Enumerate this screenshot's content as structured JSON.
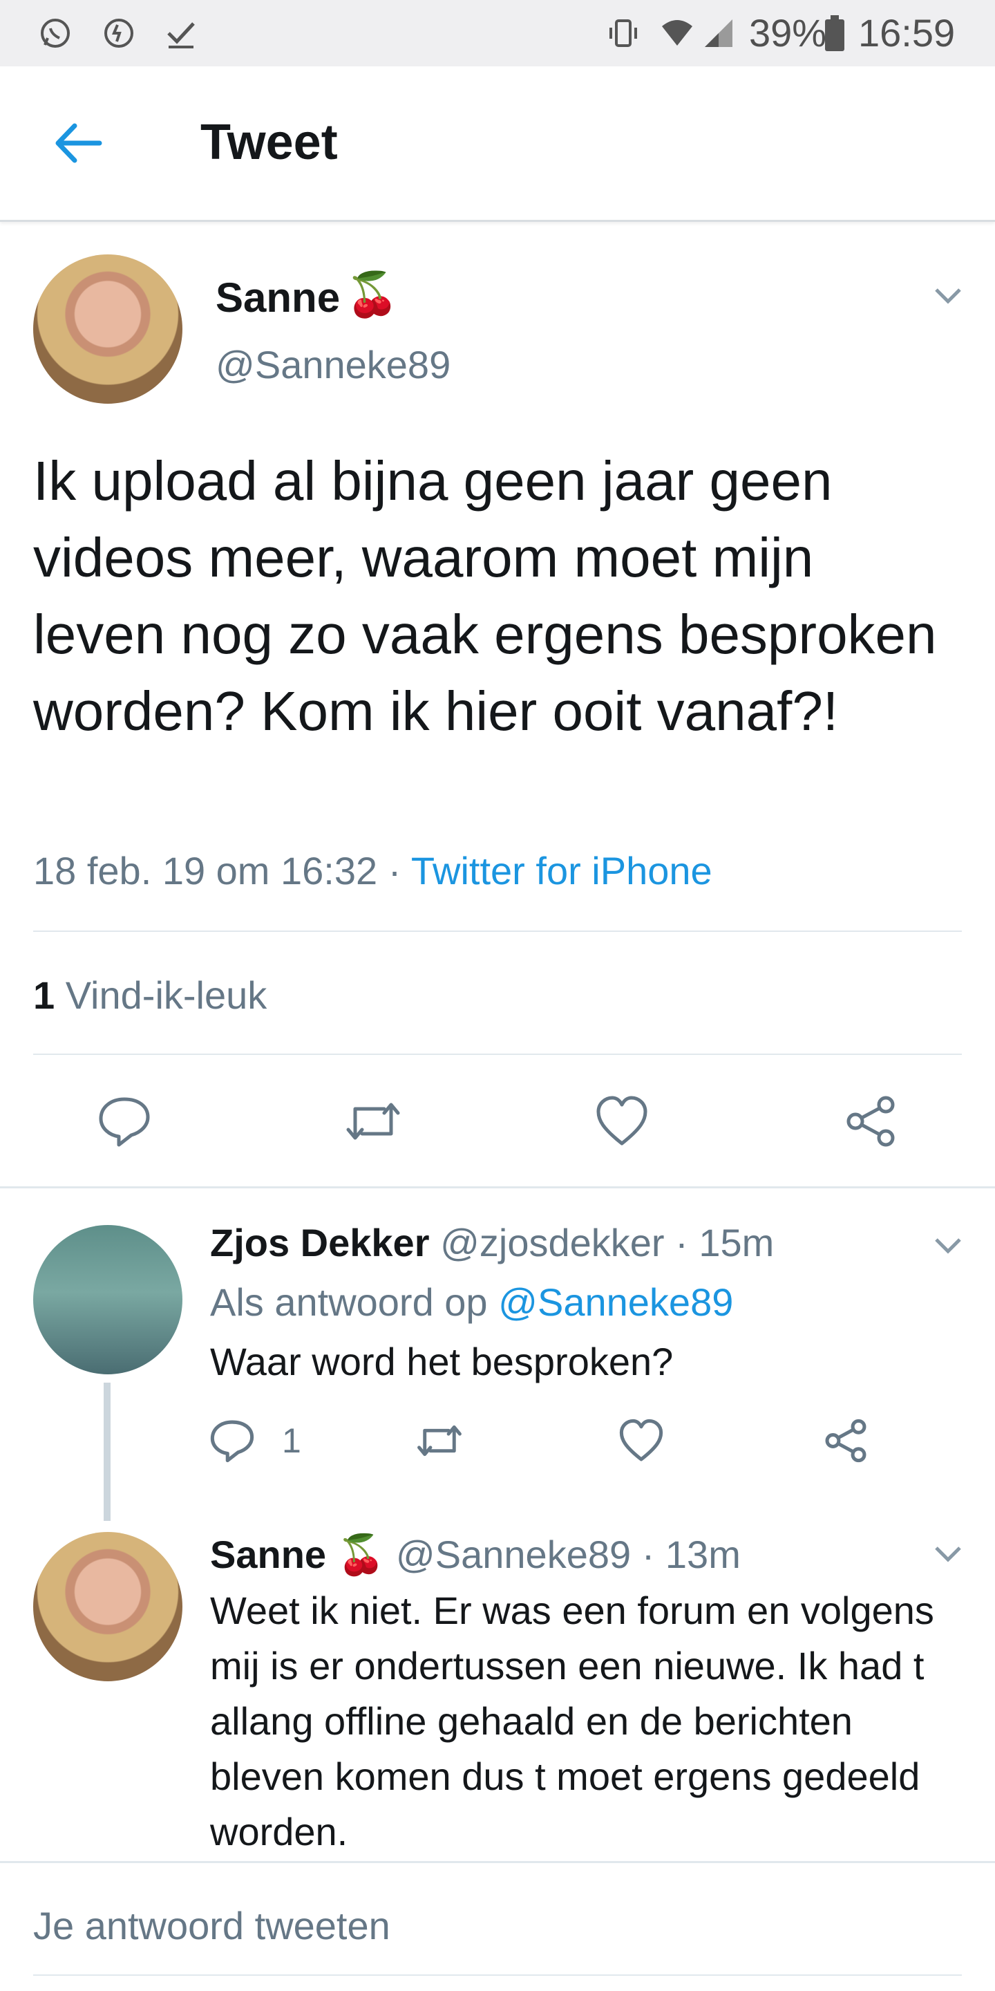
{
  "status_bar": {
    "battery": "39%",
    "time": "16:59",
    "left_icons": [
      "whatsapp-icon",
      "activity-icon",
      "check-icon"
    ],
    "right_icons": [
      "vibrate-icon",
      "wifi-icon",
      "signal-icon",
      "battery-icon"
    ]
  },
  "header": {
    "title": "Tweet"
  },
  "main_tweet": {
    "name": "Sanne",
    "emoji": "🍒",
    "handle": "@Sanneke89",
    "text": "Ik upload al bijna geen jaar geen videos meer, waarom moet mijn leven nog zo vaak ergens besproken worden? Kom ik hier ooit vanaf?!",
    "date": "18 feb. 19 om 16:32",
    "separator": " · ",
    "source": "Twitter for iPhone",
    "like_count": "1",
    "like_label": "Vind-ik-leuk"
  },
  "replies": [
    {
      "name": "Zjos Dekker",
      "handle": "@zjosdekker",
      "time": "· 15m",
      "reply_prefix": "Als antwoord op",
      "reply_to": "@Sanneke89",
      "text": "Waar word het besproken?",
      "reply_count": "1"
    },
    {
      "name": "Sanne",
      "emoji": "🍒",
      "handle": "@Sanneke89",
      "time": "· 13m",
      "text": "Weet ik niet. Er was een forum en volgens mij is er ondertussen een nieuwe. Ik had t allang offline gehaald en de berichten bleven komen dus t moet ergens gedeeld worden."
    }
  ],
  "compose": {
    "placeholder": "Je antwoord tweeten"
  },
  "colors": {
    "accent": "#1b95e0",
    "text": "#14171a",
    "muted": "#657786",
    "divider": "#e1e8ed"
  }
}
